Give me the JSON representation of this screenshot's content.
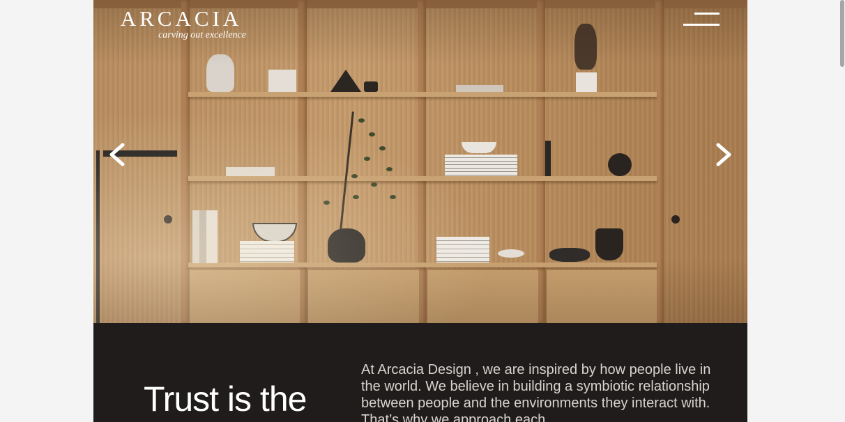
{
  "header": {
    "logo_text": "ARCACIA",
    "logo_tagline": "carving out excellence",
    "menu_icon": "hamburger-menu-icon"
  },
  "hero": {
    "prev_icon": "chevron-left-icon",
    "next_icon": "chevron-right-icon"
  },
  "intro": {
    "heading": "Trust is the",
    "paragraph": "At Arcacia Design , we are inspired by how people live in the world. We believe in building a symbiotic relationship between people and the environments they interact with. That’s why we approach each"
  },
  "colors": {
    "wood": "#c49b6d",
    "dark_section": "#1f1c1b",
    "page_background": "#f4f4f4"
  }
}
